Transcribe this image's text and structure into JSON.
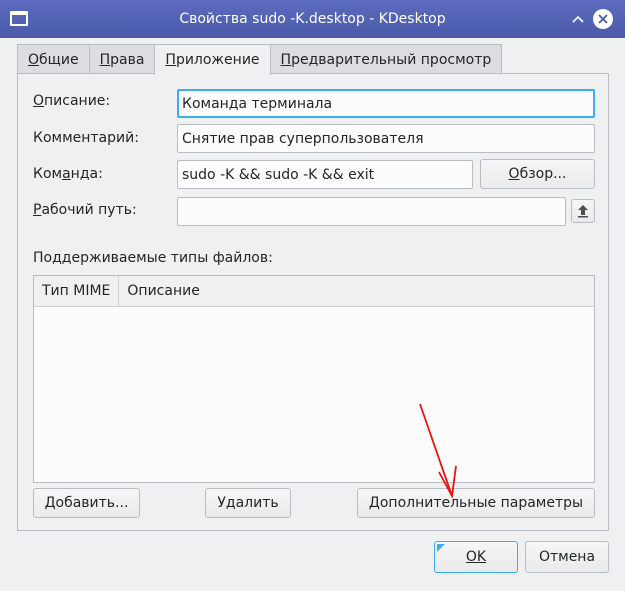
{
  "window": {
    "title": "Свойства sudo -K.desktop - KDesktop"
  },
  "tabs": [
    {
      "label": "Общие",
      "mnemonic": "О",
      "rest": "бщие"
    },
    {
      "label": "Права",
      "mnemonic": "П",
      "rest": "рава"
    },
    {
      "label": "Приложение",
      "mnemonic": "П",
      "rest": "риложение"
    },
    {
      "label": "Предварительный просмотр",
      "mnemonic": "П",
      "rest": "редварительный просмотр"
    }
  ],
  "form": {
    "description_label_m": "О",
    "description_label_r": "писание:",
    "description_value": "Команда терминала",
    "comment_label": "Комментарий:",
    "comment_value": "Снятие прав суперпользователя",
    "command_label_a": "Ком",
    "command_label_m": "а",
    "command_label_b": "нда:",
    "command_value": "sudo -K && sudo -K && exit",
    "browse_m": "О",
    "browse_r": "бзор...",
    "workdir_label_m": "Р",
    "workdir_label_r": "абочий путь:",
    "workdir_value": ""
  },
  "filetypes": {
    "label": "Поддерживаемые типы файлов:",
    "columns": [
      "Тип MIME",
      "Описание"
    ],
    "rows": []
  },
  "buttons": {
    "add": "Добавить...",
    "remove": "Удалить",
    "advanced": "Дополнительные параметры",
    "ok": "OK",
    "cancel": "Отмена"
  },
  "colors": {
    "accent": "#3daee9",
    "titlebar": "#5c6bc0",
    "annotation_arrow": "#e8140f"
  }
}
